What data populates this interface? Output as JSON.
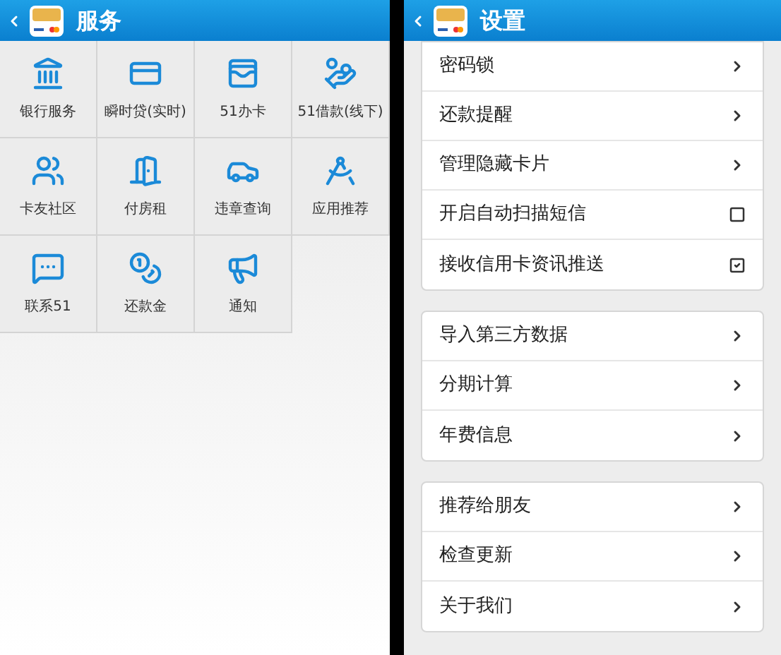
{
  "services_screen": {
    "title": "服务",
    "items": [
      {
        "label": "银行服务"
      },
      {
        "label": "瞬时贷(实时)"
      },
      {
        "label": "51办卡"
      },
      {
        "label": "51借款(线下)"
      },
      {
        "label": "卡友社区"
      },
      {
        "label": "付房租"
      },
      {
        "label": "违章查询"
      },
      {
        "label": "应用推荐"
      },
      {
        "label": "联系51"
      },
      {
        "label": "还款金"
      },
      {
        "label": "通知"
      }
    ]
  },
  "settings_screen": {
    "title": "设置",
    "groups": [
      [
        {
          "label": "密码锁",
          "kind": "link"
        },
        {
          "label": "还款提醒",
          "kind": "link"
        },
        {
          "label": "管理隐藏卡片",
          "kind": "link"
        },
        {
          "label": "开启自动扫描短信",
          "kind": "checkbox",
          "checked": false
        },
        {
          "label": "接收信用卡资讯推送",
          "kind": "checkbox",
          "checked": true
        }
      ],
      [
        {
          "label": "导入第三方数据",
          "kind": "link"
        },
        {
          "label": "分期计算",
          "kind": "link"
        },
        {
          "label": "年费信息",
          "kind": "link"
        }
      ],
      [
        {
          "label": "推荐给朋友",
          "kind": "link"
        },
        {
          "label": "检查更新",
          "kind": "link"
        },
        {
          "label": "关于我们",
          "kind": "link"
        }
      ]
    ]
  }
}
